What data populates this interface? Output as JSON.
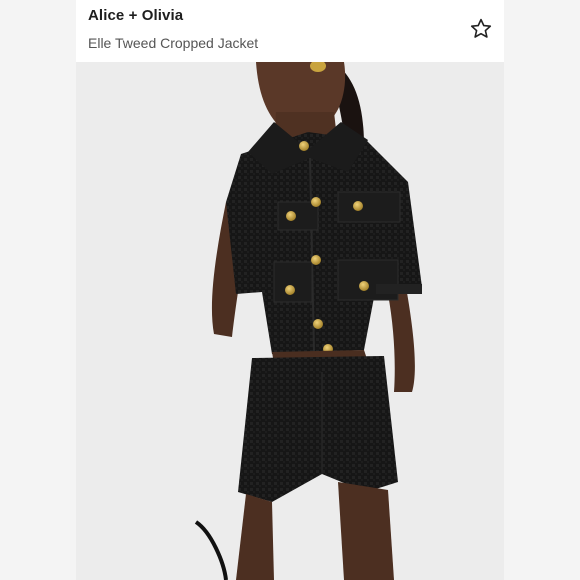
{
  "listing": {
    "brand": "Alice + Olivia",
    "product_name": "Elle Tweed Cropped Jacket"
  },
  "icons": {
    "favorite": "star-outline-icon"
  },
  "colors": {
    "garment": "#141414",
    "buttons": "#c9a43f",
    "skin": "#5c3a2a",
    "background": "#ececec"
  }
}
